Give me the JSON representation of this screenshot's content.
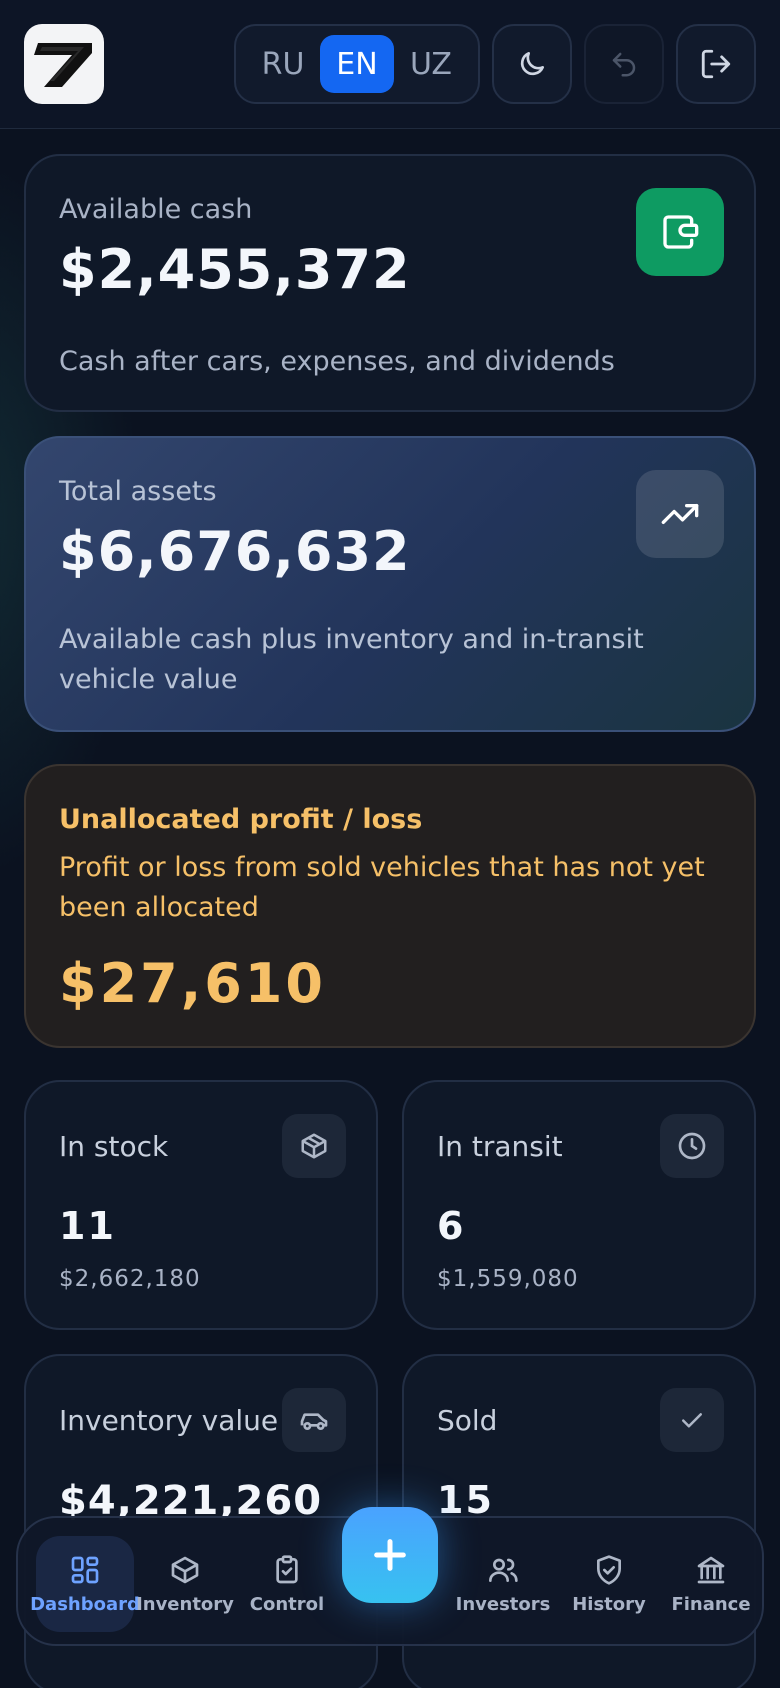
{
  "header": {
    "languages": [
      "RU",
      "EN",
      "UZ"
    ],
    "active_language": "EN",
    "icons": [
      "moon-icon",
      "undo-icon",
      "logout-icon"
    ]
  },
  "available_cash": {
    "label": "Available cash",
    "value": "$2,455,372",
    "description": "Cash after cars, expenses, and dividends",
    "icon": "wallet-icon",
    "accent": "#0e9b62"
  },
  "total_assets": {
    "label": "Total assets",
    "value": "$6,676,632",
    "description": "Available cash plus inventory and in-transit vehicle value",
    "icon": "trending-up-icon"
  },
  "unallocated": {
    "title": "Unallocated profit / loss",
    "description": "Profit or loss from sold vehicles that has not yet been allocated",
    "value": "$27,610",
    "accent": "#f6c068"
  },
  "stats": [
    {
      "label": "In stock",
      "count": "11",
      "amount": "$2,662,180",
      "icon": "box-icon"
    },
    {
      "label": "In transit",
      "count": "6",
      "amount": "$1,559,080",
      "icon": "clock-icon"
    },
    {
      "label": "Inventory value",
      "value": "$4,221,260",
      "icon": "car-icon"
    },
    {
      "label": "Sold",
      "count": "15",
      "icon": "check-icon"
    }
  ],
  "nav": {
    "items": [
      "Dashboard",
      "Inventory",
      "Control",
      "Investors",
      "History",
      "Finance"
    ],
    "active": "Dashboard",
    "accent": "#6ea2ff"
  }
}
